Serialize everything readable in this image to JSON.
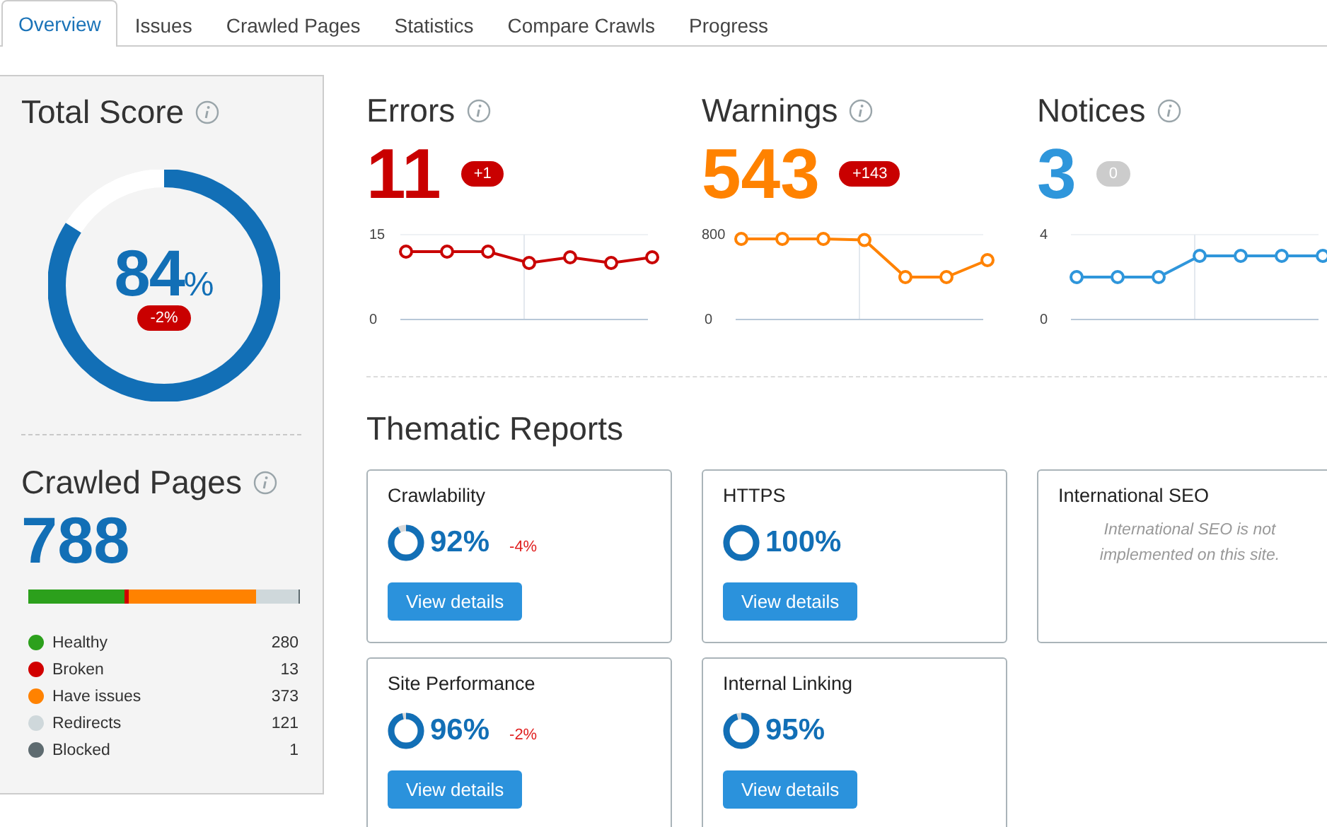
{
  "tabs": [
    {
      "label": "Overview",
      "selected": true
    },
    {
      "label": "Issues",
      "selected": false
    },
    {
      "label": "Crawled Pages",
      "selected": false
    },
    {
      "label": "Statistics",
      "selected": false
    },
    {
      "label": "Compare Crawls",
      "selected": false
    },
    {
      "label": "Progress",
      "selected": false
    }
  ],
  "total_score": {
    "title": "Total Score",
    "value": "84",
    "unit": "%",
    "change": "-2%"
  },
  "crawled_pages": {
    "title": "Crawled Pages",
    "value": "788",
    "items": [
      {
        "name": "Healthy",
        "count": "280",
        "color": "#2ca01c"
      },
      {
        "name": "Broken",
        "count": "13",
        "color": "#d10000"
      },
      {
        "name": "Have issues",
        "count": "373",
        "color": "#ff8200"
      },
      {
        "name": "Redirects",
        "count": "121",
        "color": "#cfd8db"
      },
      {
        "name": "Blocked",
        "count": "1",
        "color": "#5e6b70"
      }
    ]
  },
  "metrics": [
    {
      "title": "Errors",
      "value": "11",
      "color": "#c90000",
      "change": "+1",
      "kind": "negative",
      "chart_data": {
        "type": "line",
        "ylim": [
          0,
          15
        ],
        "yticks": [
          0,
          15
        ],
        "series": [
          {
            "marker": "circle",
            "color": "#c90000",
            "values": [
              12,
              12,
              12,
              10,
              11,
              10,
              11
            ]
          }
        ]
      }
    },
    {
      "title": "Warnings",
      "value": "543",
      "color": "#ff8200",
      "change": "+143",
      "kind": "negative",
      "chart_data": {
        "type": "line",
        "ylim": [
          0,
          800
        ],
        "yticks": [
          0,
          800
        ],
        "series": [
          {
            "marker": "circle",
            "color": "#ff8200",
            "values": [
              760,
              760,
              760,
              750,
              400,
              400,
              560
            ]
          }
        ]
      }
    },
    {
      "title": "Notices",
      "value": "3",
      "color": "#2f96db",
      "change": "0",
      "kind": "neutral",
      "chart_data": {
        "type": "line",
        "ylim": [
          0,
          4
        ],
        "yticks": [
          0,
          4
        ],
        "series": [
          {
            "marker": "circle",
            "color": "#2f96db",
            "values": [
              2,
              2,
              2,
              3,
              3,
              3,
              3
            ]
          }
        ]
      }
    }
  ],
  "thematic_reports": {
    "title": "Thematic Reports",
    "cards": [
      {
        "kind": "score",
        "title": "Crawlability",
        "value": "92%",
        "change": "-4%",
        "button": "View details"
      },
      {
        "kind": "score",
        "title": "HTTPS",
        "value": "100%",
        "button": "View details"
      },
      {
        "kind": "message",
        "title": "International SEO",
        "message": "International SEO is not implemented on this site."
      },
      {
        "kind": "score",
        "title": "Site Performance",
        "value": "96%",
        "change": "-2%",
        "button": "View details"
      },
      {
        "kind": "score",
        "title": "Internal Linking",
        "value": "95%",
        "button": "View details"
      }
    ]
  }
}
